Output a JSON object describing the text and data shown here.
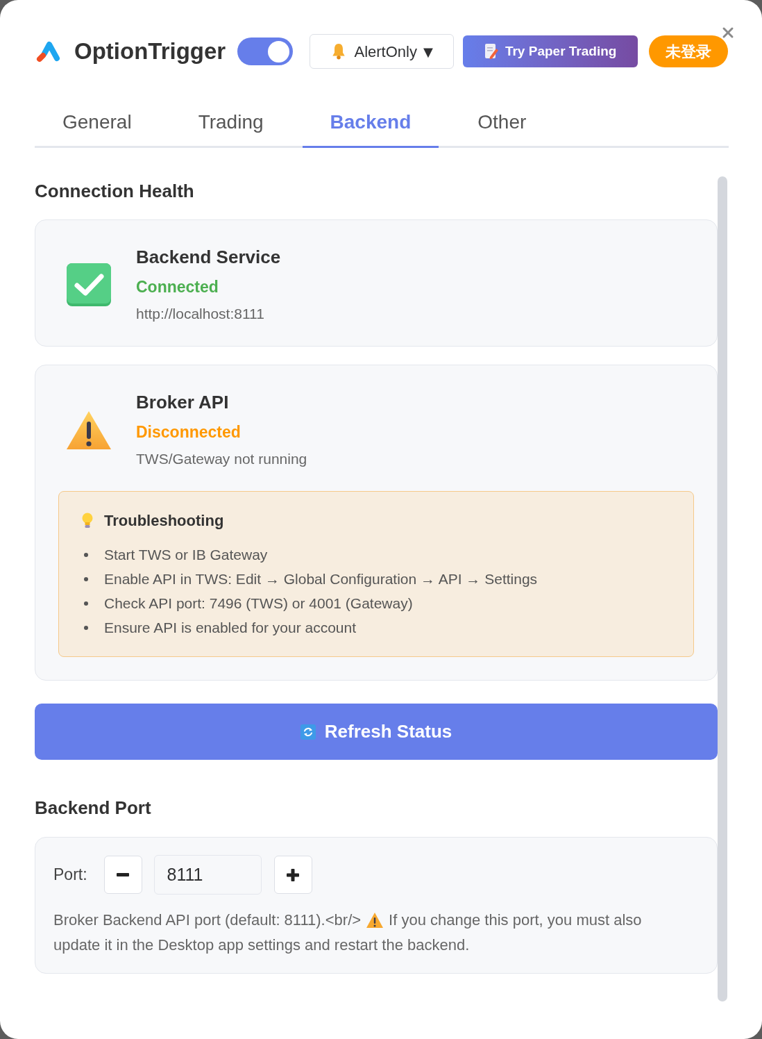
{
  "header": {
    "app_name": "OptionTrigger",
    "enabled_toggle": {
      "on": true
    },
    "mode_dropdown": {
      "value": "AlertOnly",
      "caret": "▼"
    },
    "paper_trading_button": {
      "label": "Try Paper Trading"
    },
    "login_button": {
      "label": "未登录"
    }
  },
  "tabs": [
    {
      "label": "General",
      "selected": false
    },
    {
      "label": "Trading",
      "selected": false
    },
    {
      "label": "Backend",
      "selected": true
    },
    {
      "label": "Other",
      "selected": false
    }
  ],
  "connection_health": {
    "title": "Connection Health",
    "services": [
      {
        "name": "Backend Service",
        "kind": "ok",
        "status": "Connected",
        "detail": "http://localhost:8111"
      },
      {
        "name": "Broker API",
        "kind": "warning",
        "status": "Disconnected",
        "detail": "TWS/Gateway not running",
        "troubleshooting": {
          "title": "Troubleshooting",
          "items": [
            "Start TWS or IB Gateway",
            "Enable API in TWS: Edit → Global Configuration → API → Settings",
            "Check API port: 7496 (TWS) or 4001 (Gateway)",
            "Ensure API is enabled for your account"
          ]
        }
      }
    ],
    "refresh_button": {
      "label": "Refresh Status"
    }
  },
  "backend_port": {
    "title": "Backend Port",
    "label": "Port:",
    "value": "8111",
    "help_text": {
      "before_icon": "Broker Backend API port (default: 8111).<br/>",
      "after_icon_lines": [
        "If you change this port, you must also",
        "update it in the Desktop app settings and restart the backend."
      ]
    }
  }
}
